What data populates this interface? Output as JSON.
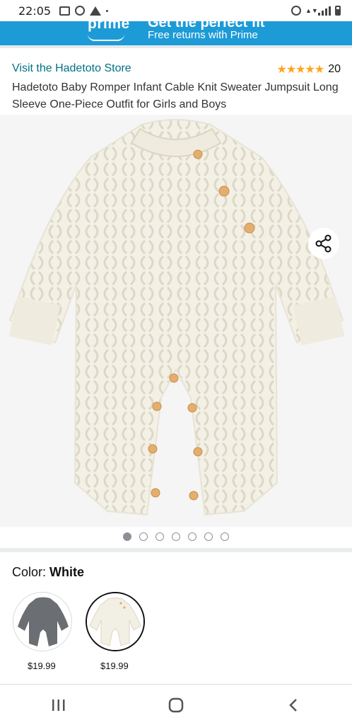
{
  "status_bar": {
    "time": "22:05"
  },
  "prime_banner": {
    "logo_text": "prime",
    "headline": "Get the perfect fit",
    "subtext": "Free returns with Prime",
    "color": "#1d9bd7"
  },
  "product": {
    "store_link": "Visit the Hadetoto Store",
    "rating_stars": "★★★★★",
    "rating_value": 4.5,
    "rating_count": "20",
    "title": "Hadetoto Baby Romper Infant Cable Knit Sweater Jumpsuit Long Sleeve One-Piece Outfit for Girls and Boys"
  },
  "gallery": {
    "total_images": 7,
    "active_index": 0
  },
  "color_selector": {
    "label": "Color:",
    "selected": "White",
    "options": [
      {
        "name": "Gray",
        "price": "$19.99",
        "swatch_color": "#6b6e72"
      },
      {
        "name": "White",
        "price": "$19.99",
        "swatch_color": "#f4f1e8"
      }
    ]
  },
  "colors": {
    "link": "#007185",
    "star": "#ffa41c",
    "image_bg": "#f5f5f5"
  },
  "icons": {
    "share": "share-icon",
    "nav_recents": "recents-icon",
    "nav_home": "home-icon",
    "nav_back": "back-icon"
  }
}
